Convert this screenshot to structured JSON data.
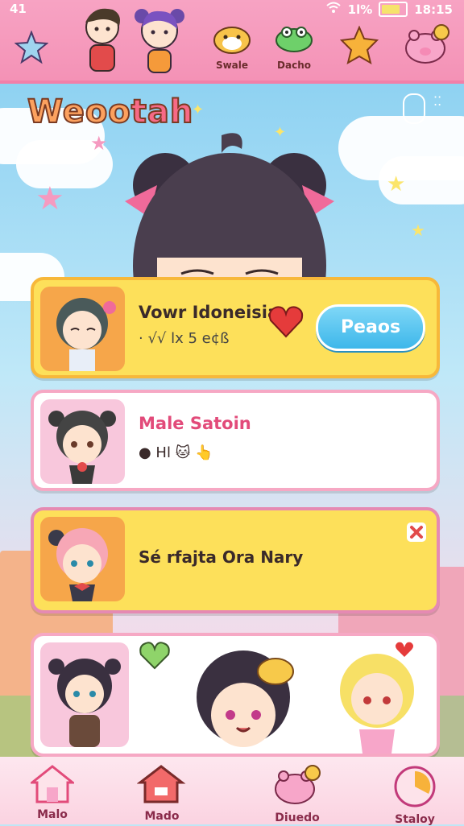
{
  "status_bar": {
    "left": "41",
    "right_percent": "1l%",
    "time": "18:15"
  },
  "top_bar": {
    "items": [
      {
        "icon": "star-icon"
      },
      {
        "icon": "boy-avatar-icon"
      },
      {
        "icon": "girl-avatar-icon"
      },
      {
        "icon": "hamster-icon",
        "label": "Swale"
      },
      {
        "icon": "frog-icon",
        "label": "Dacho"
      },
      {
        "icon": "badge-icon"
      },
      {
        "icon": "pig-icon"
      }
    ]
  },
  "app": {
    "logo_text": "Weoo",
    "logo_text_2": "tah"
  },
  "cards": [
    {
      "title": "Vowr Idoneisia",
      "subtitle": "· √√ lx 5 e¢ß",
      "button": "Peaos"
    },
    {
      "title": "Male Satoin",
      "subtitle": "● Hl 🐱 👆"
    },
    {
      "title": "Sé rfajta Ora Nary"
    },
    {
      "title": ""
    }
  ],
  "bottom_nav": [
    {
      "icon": "house-icon",
      "label": "Malo"
    },
    {
      "icon": "chat-house-icon",
      "label": "Mado"
    },
    {
      "icon": "pig-icon",
      "label": "Diuedo"
    },
    {
      "icon": "clock-icon",
      "label": "Staloy"
    }
  ],
  "colors": {
    "pink": "#f492b6",
    "yellow": "#fde05a",
    "white": "#ffffff",
    "blue_button": "#3db7ea"
  }
}
